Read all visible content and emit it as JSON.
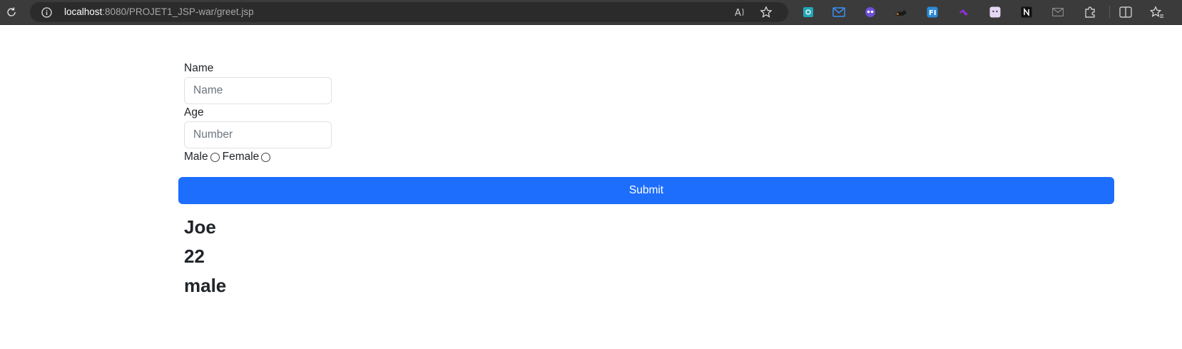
{
  "browser": {
    "url_host": "localhost",
    "url_rest": ":8080/PROJET1_JSP-war/greet.jsp",
    "icons": {
      "reload": "reload-icon",
      "site_info": "info-icon",
      "read_aloud": "read-aloud-icon",
      "favorite": "star-icon",
      "extensions": [
        "extension-teal-icon",
        "mail-icon",
        "ghost-extension-icon",
        "fox-extension-icon",
        "fi-extension-icon",
        "visualstudio-extension-icon",
        "cat-extension-icon",
        "n-extension-icon",
        "envelope-extension-icon",
        "puzzle-icon",
        "split-screen-icon",
        "favorites-icon"
      ]
    }
  },
  "form": {
    "name_label": "Name",
    "name_placeholder": "Name",
    "name_value": "",
    "age_label": "Age",
    "age_placeholder": "Number",
    "age_value": "",
    "gender_options": [
      "Male",
      "Female"
    ],
    "gender_selected": null,
    "submit_label": "Submit",
    "submit_color": "#1d6efd"
  },
  "result": {
    "name": "Joe",
    "age": "22",
    "gender": "male"
  }
}
